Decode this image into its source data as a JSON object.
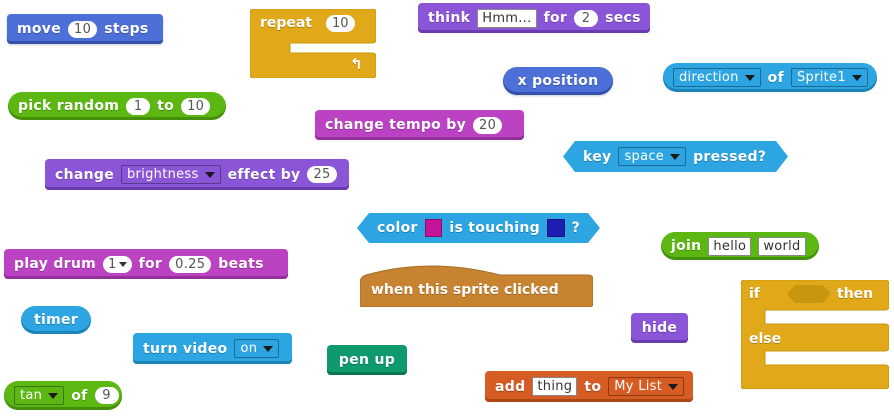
{
  "blocks": {
    "move": {
      "before": "move",
      "value": "10",
      "after": "steps"
    },
    "repeat": {
      "label": "repeat",
      "value": "10",
      "arrow": "↰"
    },
    "think": {
      "label": "think",
      "text": "Hmm...",
      "for": "for",
      "value": "2",
      "unit": "secs"
    },
    "x_position": {
      "label": "x position"
    },
    "direction_of": {
      "prop": "direction",
      "of": "of",
      "sprite": "Sprite1"
    },
    "pick_random": {
      "label": "pick random",
      "from": "1",
      "to": "to",
      "to_value": "10"
    },
    "change_tempo": {
      "label": "change tempo by",
      "value": "20"
    },
    "key_pressed": {
      "label": "key",
      "key": "space",
      "after": "pressed?"
    },
    "change_effect": {
      "label": "change",
      "effect": "brightness",
      "after": "effect by",
      "value": "25"
    },
    "color_touching": {
      "label1": "color",
      "label2": "is touching",
      "label3": "?",
      "color1": "#c5149b",
      "color2": "#1d1db2"
    },
    "join": {
      "label": "join",
      "a": "hello",
      "b": "world"
    },
    "play_drum": {
      "label": "play drum",
      "drum": "1",
      "for": "for",
      "value": "0.25",
      "unit": "beats"
    },
    "when_clicked": {
      "label": "when this sprite clicked"
    },
    "if_else": {
      "if": "if",
      "then": "then",
      "else": "else"
    },
    "timer": {
      "label": "timer"
    },
    "turn_video": {
      "label": "turn video",
      "state": "on"
    },
    "pen_up": {
      "label": "pen up"
    },
    "hide": {
      "label": "hide"
    },
    "tan_of": {
      "func": "tan",
      "of": "of",
      "value": "9"
    },
    "add_to": {
      "label": "add",
      "item": "thing",
      "to": "to",
      "list": "My List"
    }
  },
  "colors": {
    "motion": "#4c6fd8",
    "control": "#e1a91a",
    "looks": "#8a55d7",
    "sound": "#bb42c3",
    "operators": "#5cb712",
    "sensing": "#2ca5e2",
    "pen": "#0e9a6c",
    "events": "#c88330",
    "data": "#d65c23"
  }
}
